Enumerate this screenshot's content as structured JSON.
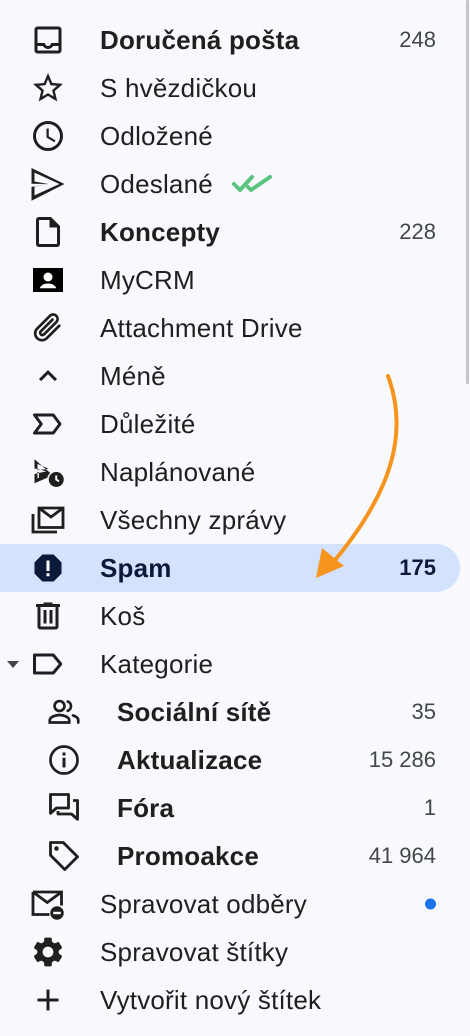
{
  "colors": {
    "background": "#f7f9fc",
    "active_background": "#d3e3fd",
    "icon": "#1f1f1f",
    "spam_icon": "#0b1a3a",
    "check_green": "#5bc47e",
    "arrow_orange": "#f7941d",
    "dot_blue": "#1a73e8"
  },
  "folders": {
    "inbox": {
      "label": "Doručená pošta",
      "count": "248",
      "icon": "inbox-icon"
    },
    "starred": {
      "label": "S hvězdičkou",
      "icon": "star-icon"
    },
    "snoozed": {
      "label": "Odložené",
      "icon": "clock-icon"
    },
    "sent": {
      "label": "Odeslané",
      "icon": "send-icon",
      "badge_icon": "double-check-icon"
    },
    "drafts": {
      "label": "Koncepty",
      "count": "228",
      "icon": "file-icon"
    },
    "mycrm": {
      "label": "MyCRM",
      "icon": "contact-card-icon"
    },
    "attachment_drive": {
      "label": "Attachment Drive",
      "icon": "paperclip-icon"
    },
    "less": {
      "label": "Méně",
      "icon": "chevron-up-icon"
    },
    "important": {
      "label": "Důležité",
      "icon": "label-important-icon"
    },
    "scheduled": {
      "label": "Naplánované",
      "icon": "schedule-send-icon"
    },
    "all_mail": {
      "label": "Všechny zprávy",
      "icon": "all-mail-icon"
    },
    "spam": {
      "label": "Spam",
      "count": "175",
      "icon": "report-icon"
    },
    "trash": {
      "label": "Koš",
      "icon": "trash-icon"
    },
    "categories": {
      "label": "Kategorie",
      "icon": "label-icon"
    },
    "social": {
      "label": "Sociální sítě",
      "count": "35",
      "icon": "people-icon"
    },
    "updates": {
      "label": "Aktualizace",
      "count": "15 286",
      "icon": "info-icon"
    },
    "forums": {
      "label": "Fóra",
      "count": "1",
      "icon": "forum-icon"
    },
    "promotions": {
      "label": "Promoakce",
      "count": "41 964",
      "icon": "tag-icon"
    },
    "manage_subscriptions": {
      "label": "Spravovat odběry",
      "icon": "unsubscribe-icon",
      "has_unread_dot": true
    },
    "manage_labels": {
      "label": "Spravovat štítky",
      "icon": "gear-icon"
    },
    "create_label": {
      "label": "Vytvořit nový štítek",
      "icon": "plus-icon"
    }
  }
}
